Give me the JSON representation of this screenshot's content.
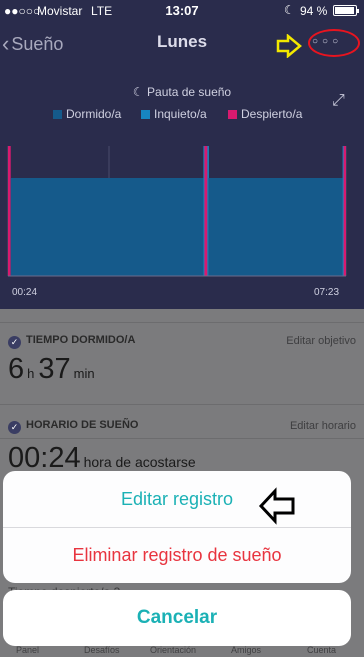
{
  "status": {
    "signal": "●●○○○",
    "carrier": "Movistar",
    "network": "LTE",
    "time": "13:07",
    "moon": "☾",
    "battery": "94 %"
  },
  "nav": {
    "back_chevron": "‹",
    "back_label": "Sueño",
    "title": "Lunes",
    "more": "○○○"
  },
  "chart_data": {
    "type": "timeline",
    "title": "Pauta de sueño",
    "legend": [
      "Dormido/a",
      "Inquieto/a",
      "Despierto/a"
    ],
    "x_labels": [
      "00:24",
      "07:23"
    ],
    "colors": {
      "dormido": "#155a8b",
      "inquieto": "#1786c2",
      "despierto": "#d81a6f",
      "bg": "#2a2c4c"
    },
    "segments": [
      {
        "state": "despierto",
        "start": 0.0,
        "end": 0.008
      },
      {
        "state": "dormido",
        "start": 0.008,
        "end": 0.578
      },
      {
        "state": "inquieto",
        "start": 0.578,
        "end": 0.581
      },
      {
        "state": "despierto",
        "start": 0.581,
        "end": 0.59
      },
      {
        "state": "inquieto",
        "start": 0.59,
        "end": 0.593
      },
      {
        "state": "dormido",
        "start": 0.593,
        "end": 0.99
      },
      {
        "state": "inquieto",
        "start": 0.99,
        "end": 0.993
      },
      {
        "state": "despierto",
        "start": 0.993,
        "end": 1.0
      }
    ]
  },
  "legend_title_icon": "☾",
  "expand_icon": "⤢",
  "sections": {
    "tiempo": {
      "title": "TIEMPO DORMIDO/A",
      "link": "Editar objetivo",
      "hours": "6",
      "h_unit": "h",
      "minutes": "37",
      "m_unit": "min"
    },
    "horario": {
      "title": "HORARIO DE SUEÑO",
      "link": "Editar horario",
      "value": "00:24",
      "caption": "hora de acostarse"
    },
    "partial": "Tiempo despierto/a   3"
  },
  "tabs": [
    "Panel",
    "Desafíos",
    "Orientación",
    "Amigos",
    "Cuenta"
  ],
  "sheet": {
    "edit": "Editar registro",
    "delete": "Eliminar registro de sueño",
    "cancel": "Cancelar",
    "edit_color": "#1bb1b5",
    "delete_color": "#e8343f"
  },
  "check_icon": "✓"
}
